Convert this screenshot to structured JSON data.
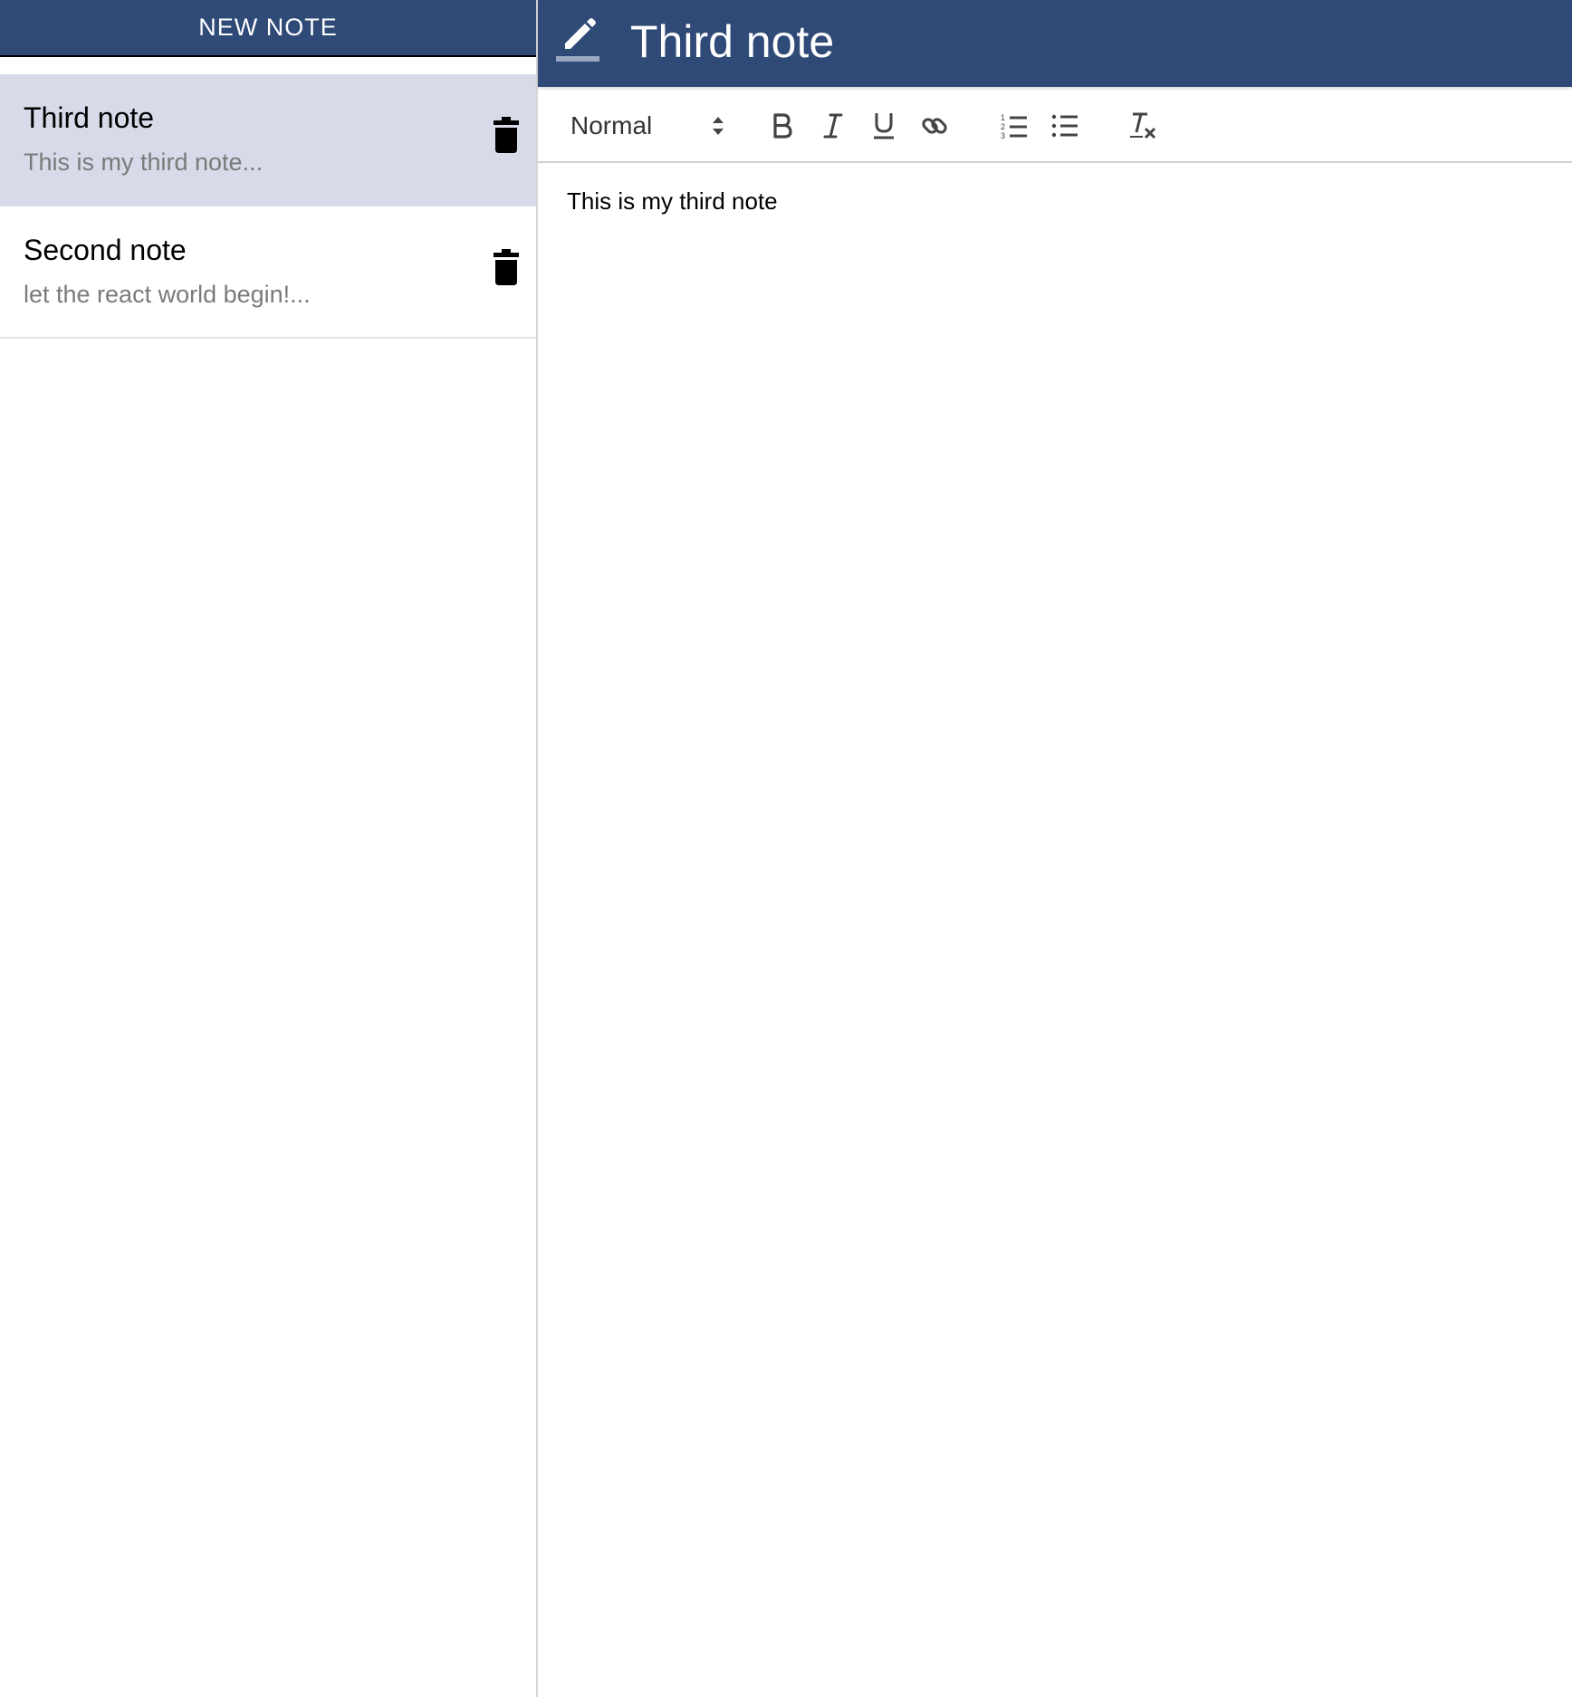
{
  "sidebar": {
    "new_note_label": "NEW NOTE",
    "notes": [
      {
        "title": "Third note",
        "preview": "This is my third note...",
        "selected": true
      },
      {
        "title": "Second note",
        "preview": "let the react world begin!...",
        "selected": false
      }
    ]
  },
  "editor": {
    "title": "Third note",
    "toolbar": {
      "format_value": "Normal",
      "buttons": [
        "bold-icon",
        "italic-icon",
        "underline-icon",
        "link-icon",
        "ordered-list-icon",
        "bullet-list-icon",
        "clear-format-icon"
      ]
    },
    "content": "This is my third note"
  },
  "colors": {
    "header": "#2f4a77",
    "selected_item": "#d7dae8",
    "preview_text": "#7a7a7a"
  }
}
